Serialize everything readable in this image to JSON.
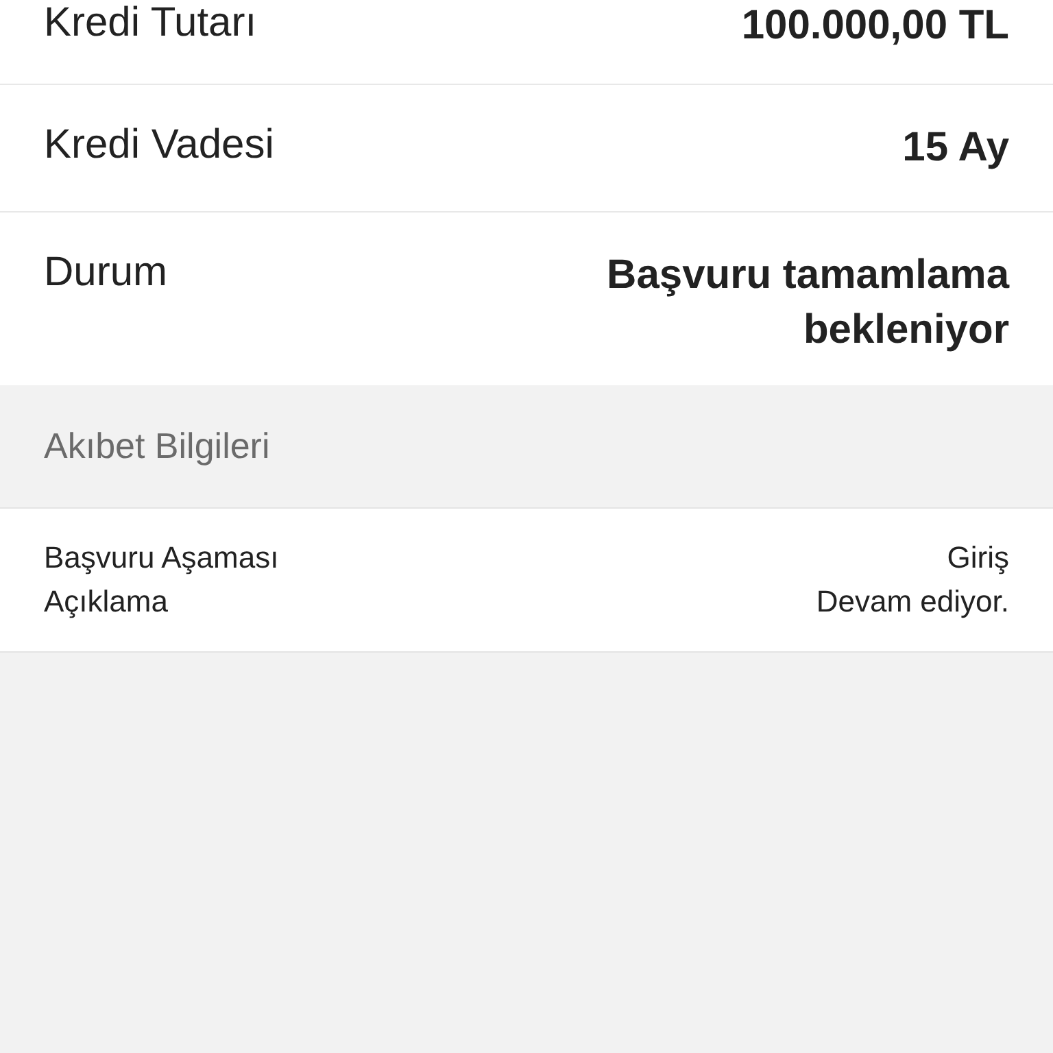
{
  "summary": [
    {
      "label": "Kredi Tutarı",
      "value": "100.000,00 TL"
    },
    {
      "label": "Kredi Vadesi",
      "value": "15 Ay"
    },
    {
      "label": "Durum",
      "value": "Başvuru tamamlama bekleniyor"
    }
  ],
  "section": {
    "title": "Akıbet Bilgileri"
  },
  "details": [
    {
      "label": "Başvuru Aşaması",
      "value": "Giriş"
    },
    {
      "label": "Açıklama",
      "value": "Devam ediyor."
    }
  ]
}
